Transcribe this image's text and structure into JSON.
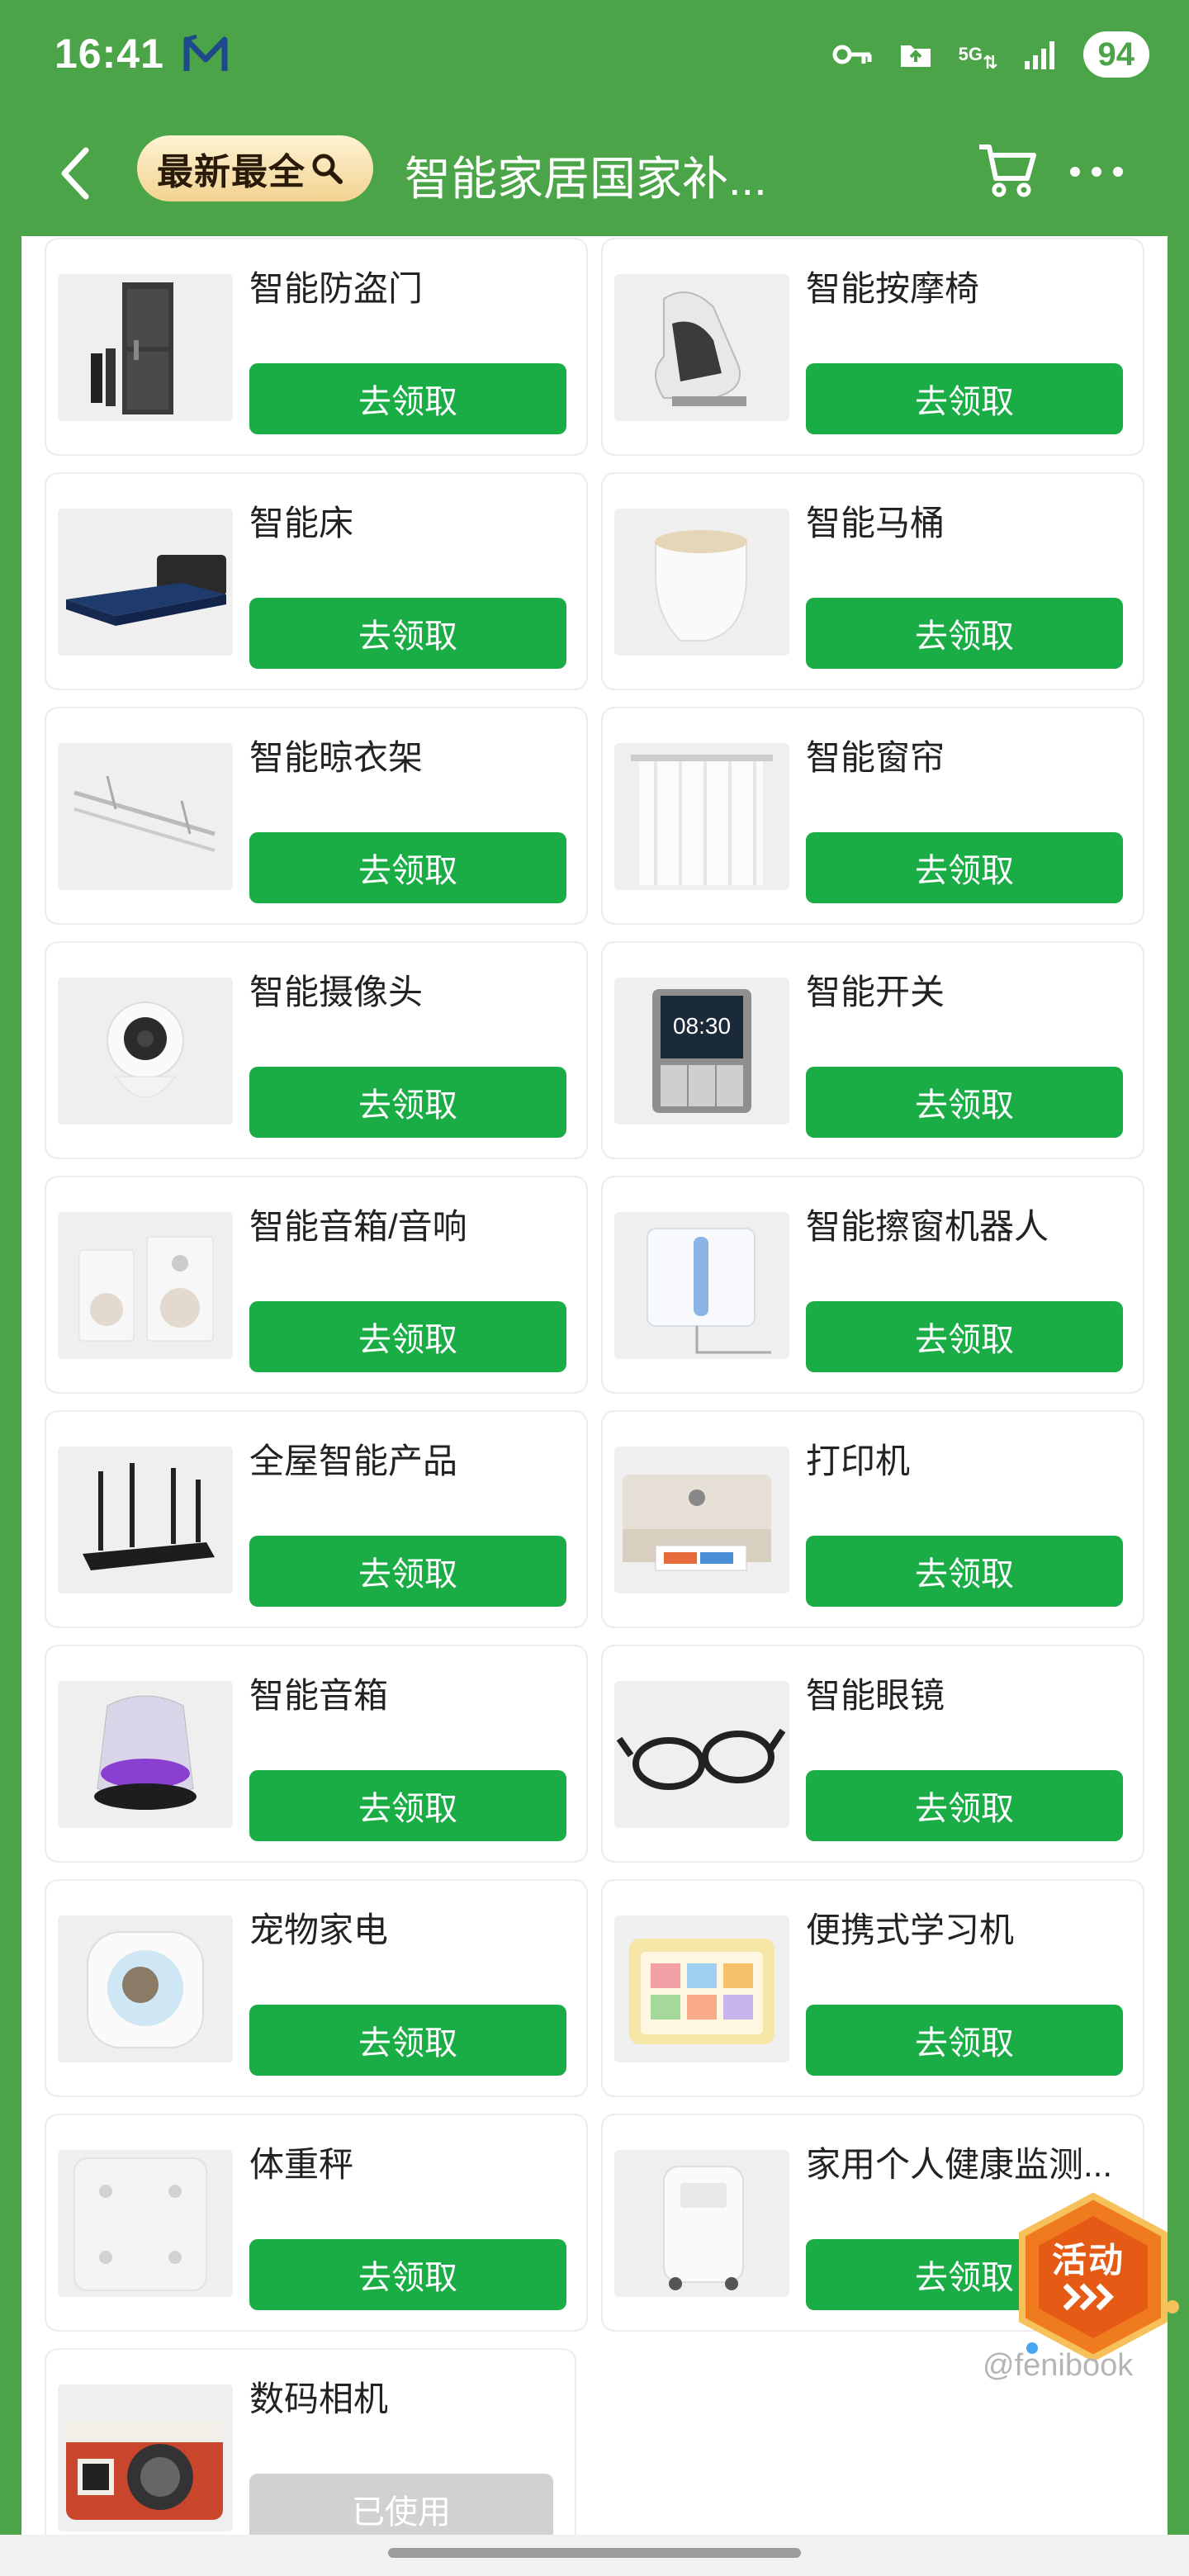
{
  "status": {
    "time": "16:41",
    "network": "5G",
    "battery": "94"
  },
  "header": {
    "badge_text": "最新最全",
    "title": "智能家居国家补..."
  },
  "products": [
    {
      "name": "智能防盗门",
      "button": "去领取",
      "used": false,
      "icon": "door-image"
    },
    {
      "name": "智能按摩椅",
      "button": "去领取",
      "used": false,
      "icon": "massage-chair-image"
    },
    {
      "name": "智能床",
      "button": "去领取",
      "used": false,
      "icon": "bed-image"
    },
    {
      "name": "智能马桶",
      "button": "去领取",
      "used": false,
      "icon": "toilet-image"
    },
    {
      "name": "智能晾衣架",
      "button": "去领取",
      "used": false,
      "icon": "clothes-rack-image"
    },
    {
      "name": "智能窗帘",
      "button": "去领取",
      "used": false,
      "icon": "curtain-image"
    },
    {
      "name": "智能摄像头",
      "button": "去领取",
      "used": false,
      "icon": "camera-image"
    },
    {
      "name": "智能开关",
      "button": "去领取",
      "used": false,
      "icon": "switch-panel-image",
      "panel_time": "08:30"
    },
    {
      "name": "智能音箱/音响",
      "button": "去领取",
      "used": false,
      "icon": "speakers-image"
    },
    {
      "name": "智能擦窗机器人",
      "button": "去领取",
      "used": false,
      "icon": "window-robot-image"
    },
    {
      "name": "全屋智能产品",
      "button": "去领取",
      "used": false,
      "icon": "router-image"
    },
    {
      "name": "打印机",
      "button": "去领取",
      "used": false,
      "icon": "printer-image"
    },
    {
      "name": "智能音箱",
      "button": "去领取",
      "used": false,
      "icon": "smart-speaker-image"
    },
    {
      "name": "智能眼镜",
      "button": "去领取",
      "used": false,
      "icon": "glasses-image"
    },
    {
      "name": "宠物家电",
      "button": "去领取",
      "used": false,
      "icon": "pet-litter-box-image"
    },
    {
      "name": "便携式学习机",
      "button": "去领取",
      "used": false,
      "icon": "learning-tablet-image"
    },
    {
      "name": "体重秤",
      "button": "去领取",
      "used": false,
      "icon": "scale-image"
    },
    {
      "name": "家用个人健康监测...",
      "button": "去领取",
      "used": false,
      "icon": "oxygen-concentrator-image"
    },
    {
      "name": "数码相机",
      "button": "已使用",
      "used": true,
      "icon": "digital-camera-image"
    }
  ],
  "floating": {
    "label": "活动"
  },
  "watermark": "@fenibook",
  "colors": {
    "brand_green": "#4ba447",
    "button_green": "#1aad46",
    "used_gray": "#d1d1d1"
  }
}
